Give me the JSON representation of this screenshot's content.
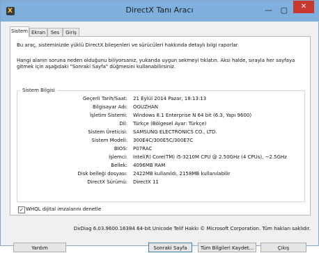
{
  "window": {
    "title": "DirectX Tanı Aracı",
    "controls": {
      "minimize": "—",
      "maximize": "▢",
      "close": "✕"
    }
  },
  "tabs": [
    "Sistem",
    "Ekran",
    "Ses",
    "Giriş"
  ],
  "active_tab": "Sistem",
  "intro": {
    "line1": "Bu araç, sisteminizde yüklü DirectX bileşenleri ve sürücüleri hakkında detaylı bilgi raporlar.",
    "line2": "Hangi alanın soruna neden olduğunu biliyorsanız, yukarıda uygun sekmeyi tıklatın.  Aksi halde, sırayla her sayfaya gitmek için aşağıdaki \"Sonraki Sayfa\" düğmesini kullanabilirsiniz."
  },
  "system_info": {
    "title": "Sistem Bilgisi",
    "rows": [
      {
        "label": "Geçerli Tarih/Saat:",
        "value": "21 Eylül 2014 Pazar, 18:13:13"
      },
      {
        "label": "Bilgisayar Adı:",
        "value": "OGUZHAN"
      },
      {
        "label": "İşletim Sistemi:",
        "value": "Windows 8.1 Enterprise N 64 bit (6.3, Yapı 9600)"
      },
      {
        "label": "Dil:",
        "value": "Türkçe (Bölgesel Ayar: Türkçe)"
      },
      {
        "label": "Sistem Üreticisi:",
        "value": "SAMSUNG ELECTRONICS CO., LTD."
      },
      {
        "label": "Sistem Modeli:",
        "value": "300E4C/300E5C/300E7C"
      },
      {
        "label": "BIOS:",
        "value": "P07RAC"
      },
      {
        "label": "İşlemci:",
        "value": "Intel(R) Core(TM) i5-3210M CPU @ 2.50GHz (4 CPUs), ~2.5GHz"
      },
      {
        "label": "Bellek:",
        "value": "4096MB RAM"
      },
      {
        "label": "Disk belleği dosyası:",
        "value": "2422MB kullanıldı, 2158MB kullanılabilir"
      },
      {
        "label": "DirectX Sürümü:",
        "value": "DirectX 11"
      }
    ]
  },
  "whql": {
    "label": "WHQL dijital imzalarını denetle",
    "checked": true,
    "mark": "✓"
  },
  "footer": "DxDiag 6.03.9600.16384 64-bit Unicode  Telif Hakkı © Microsoft Corporation. Tüm hakları saklıdır.",
  "buttons": {
    "help": "Yardım",
    "next": "Sonraki Sayfa",
    "save_all": "Tüm Bilgileri Kaydet...",
    "exit": "Çıkış"
  }
}
